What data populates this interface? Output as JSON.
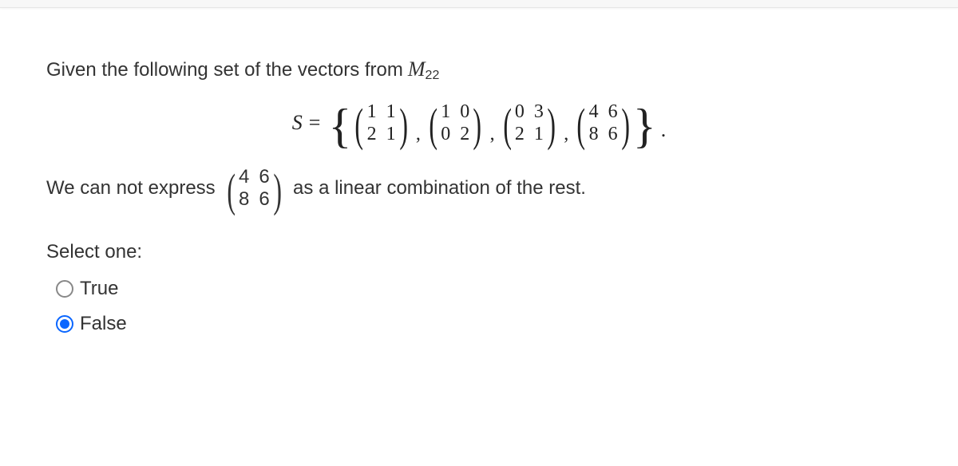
{
  "question": {
    "intro_prefix": "Given the following set of the vectors from",
    "space_symbol": "M",
    "space_subscript": "22",
    "set_symbol": "S",
    "equals": "=",
    "matrices": [
      [
        [
          "1",
          "1"
        ],
        [
          "2",
          "1"
        ]
      ],
      [
        [
          "1",
          "0"
        ],
        [
          "0",
          "2"
        ]
      ],
      [
        [
          "0",
          "3"
        ],
        [
          "2",
          "1"
        ]
      ],
      [
        [
          "4",
          "6"
        ],
        [
          "8",
          "6"
        ]
      ]
    ],
    "tail_period": ".",
    "claim_prefix": "We can not express",
    "claim_matrix": [
      [
        "4",
        "6"
      ],
      [
        "8",
        "6"
      ]
    ],
    "claim_suffix": "as a linear combination of the rest."
  },
  "prompt": {
    "select_label": "Select one:",
    "options": [
      {
        "label": "True",
        "selected": false
      },
      {
        "label": "False",
        "selected": true
      }
    ]
  }
}
